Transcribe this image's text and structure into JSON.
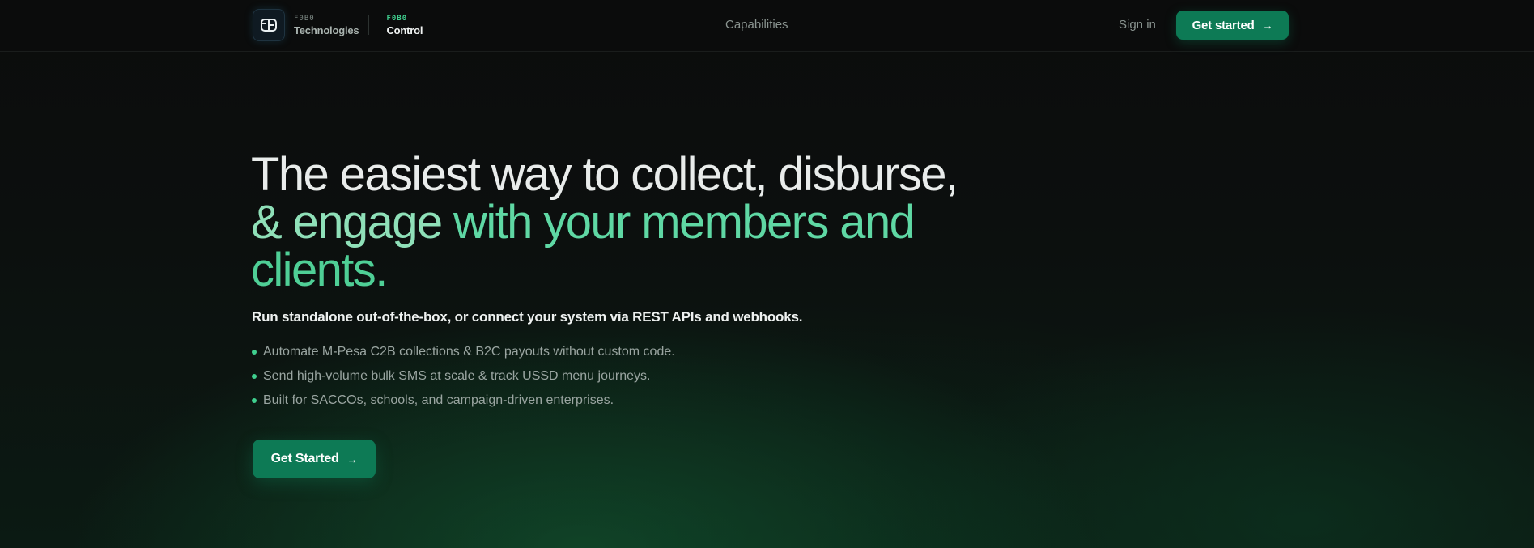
{
  "nav": {
    "brand": {
      "logo_icon": "fb-monogram-icon",
      "company_small": "F0B0",
      "company_name": "Technologies",
      "product_small": "F0B0",
      "product_name": "Control"
    },
    "links": {
      "capabilities": "Capabilities",
      "sign_in": "Sign in"
    },
    "cta": {
      "label": "Get started",
      "icon": "arrow-right-icon"
    }
  },
  "hero": {
    "headline": {
      "part1": "The easiest way to collect, disburse,",
      "part2": "& engage",
      "part3": " with your members and",
      "part4": "clients."
    },
    "subline": "Run standalone out-of-the-box, or connect your system via REST APIs and webhooks.",
    "bullets": [
      "Automate M-Pesa C2B collections & B2C payouts without custom code.",
      "Send high-volume bulk SMS at scale & track USSD menu journeys.",
      "Built for SACCOs, schools, and campaign-driven enterprises."
    ],
    "cta": {
      "label": "Get Started",
      "icon": "arrow-right-icon"
    }
  },
  "colors": {
    "accent": "#0d7a55",
    "accent_text": "#3fcf8e",
    "background": "#0b0c0c"
  }
}
